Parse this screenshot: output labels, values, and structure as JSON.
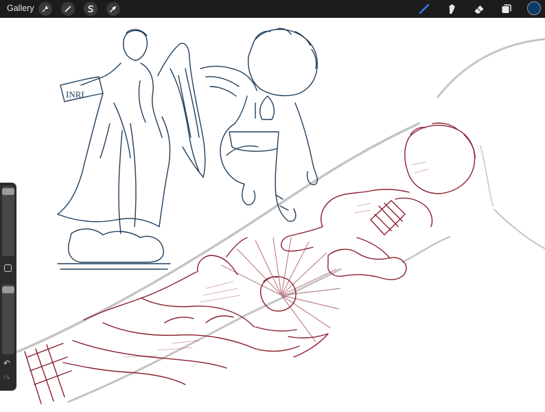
{
  "app": {
    "gallery_label": "Gallery"
  },
  "toolbar": {
    "left_tools": [
      "wrench-icon",
      "magic-wand-icon",
      "selection-icon",
      "transform-icon"
    ],
    "right_tools": [
      "brush-icon",
      "smudge-icon",
      "eraser-icon",
      "layers-icon"
    ],
    "active_tool": "brush-icon",
    "accent_color": "#2f7cf6",
    "current_color": "#0a3a66"
  },
  "sidebar": {
    "undo_icon": "undo-icon",
    "redo_icon": "redo-icon",
    "modify_icon": "modify-square-icon",
    "brush_size_level": 0.95,
    "opacity_level": 0.98
  },
  "canvas": {
    "sketch_color": "#1f3e5a",
    "tattoo_color": "#8a1e2e",
    "sleeve_color": "#b9b9b9",
    "scroll_text": "INRI"
  }
}
